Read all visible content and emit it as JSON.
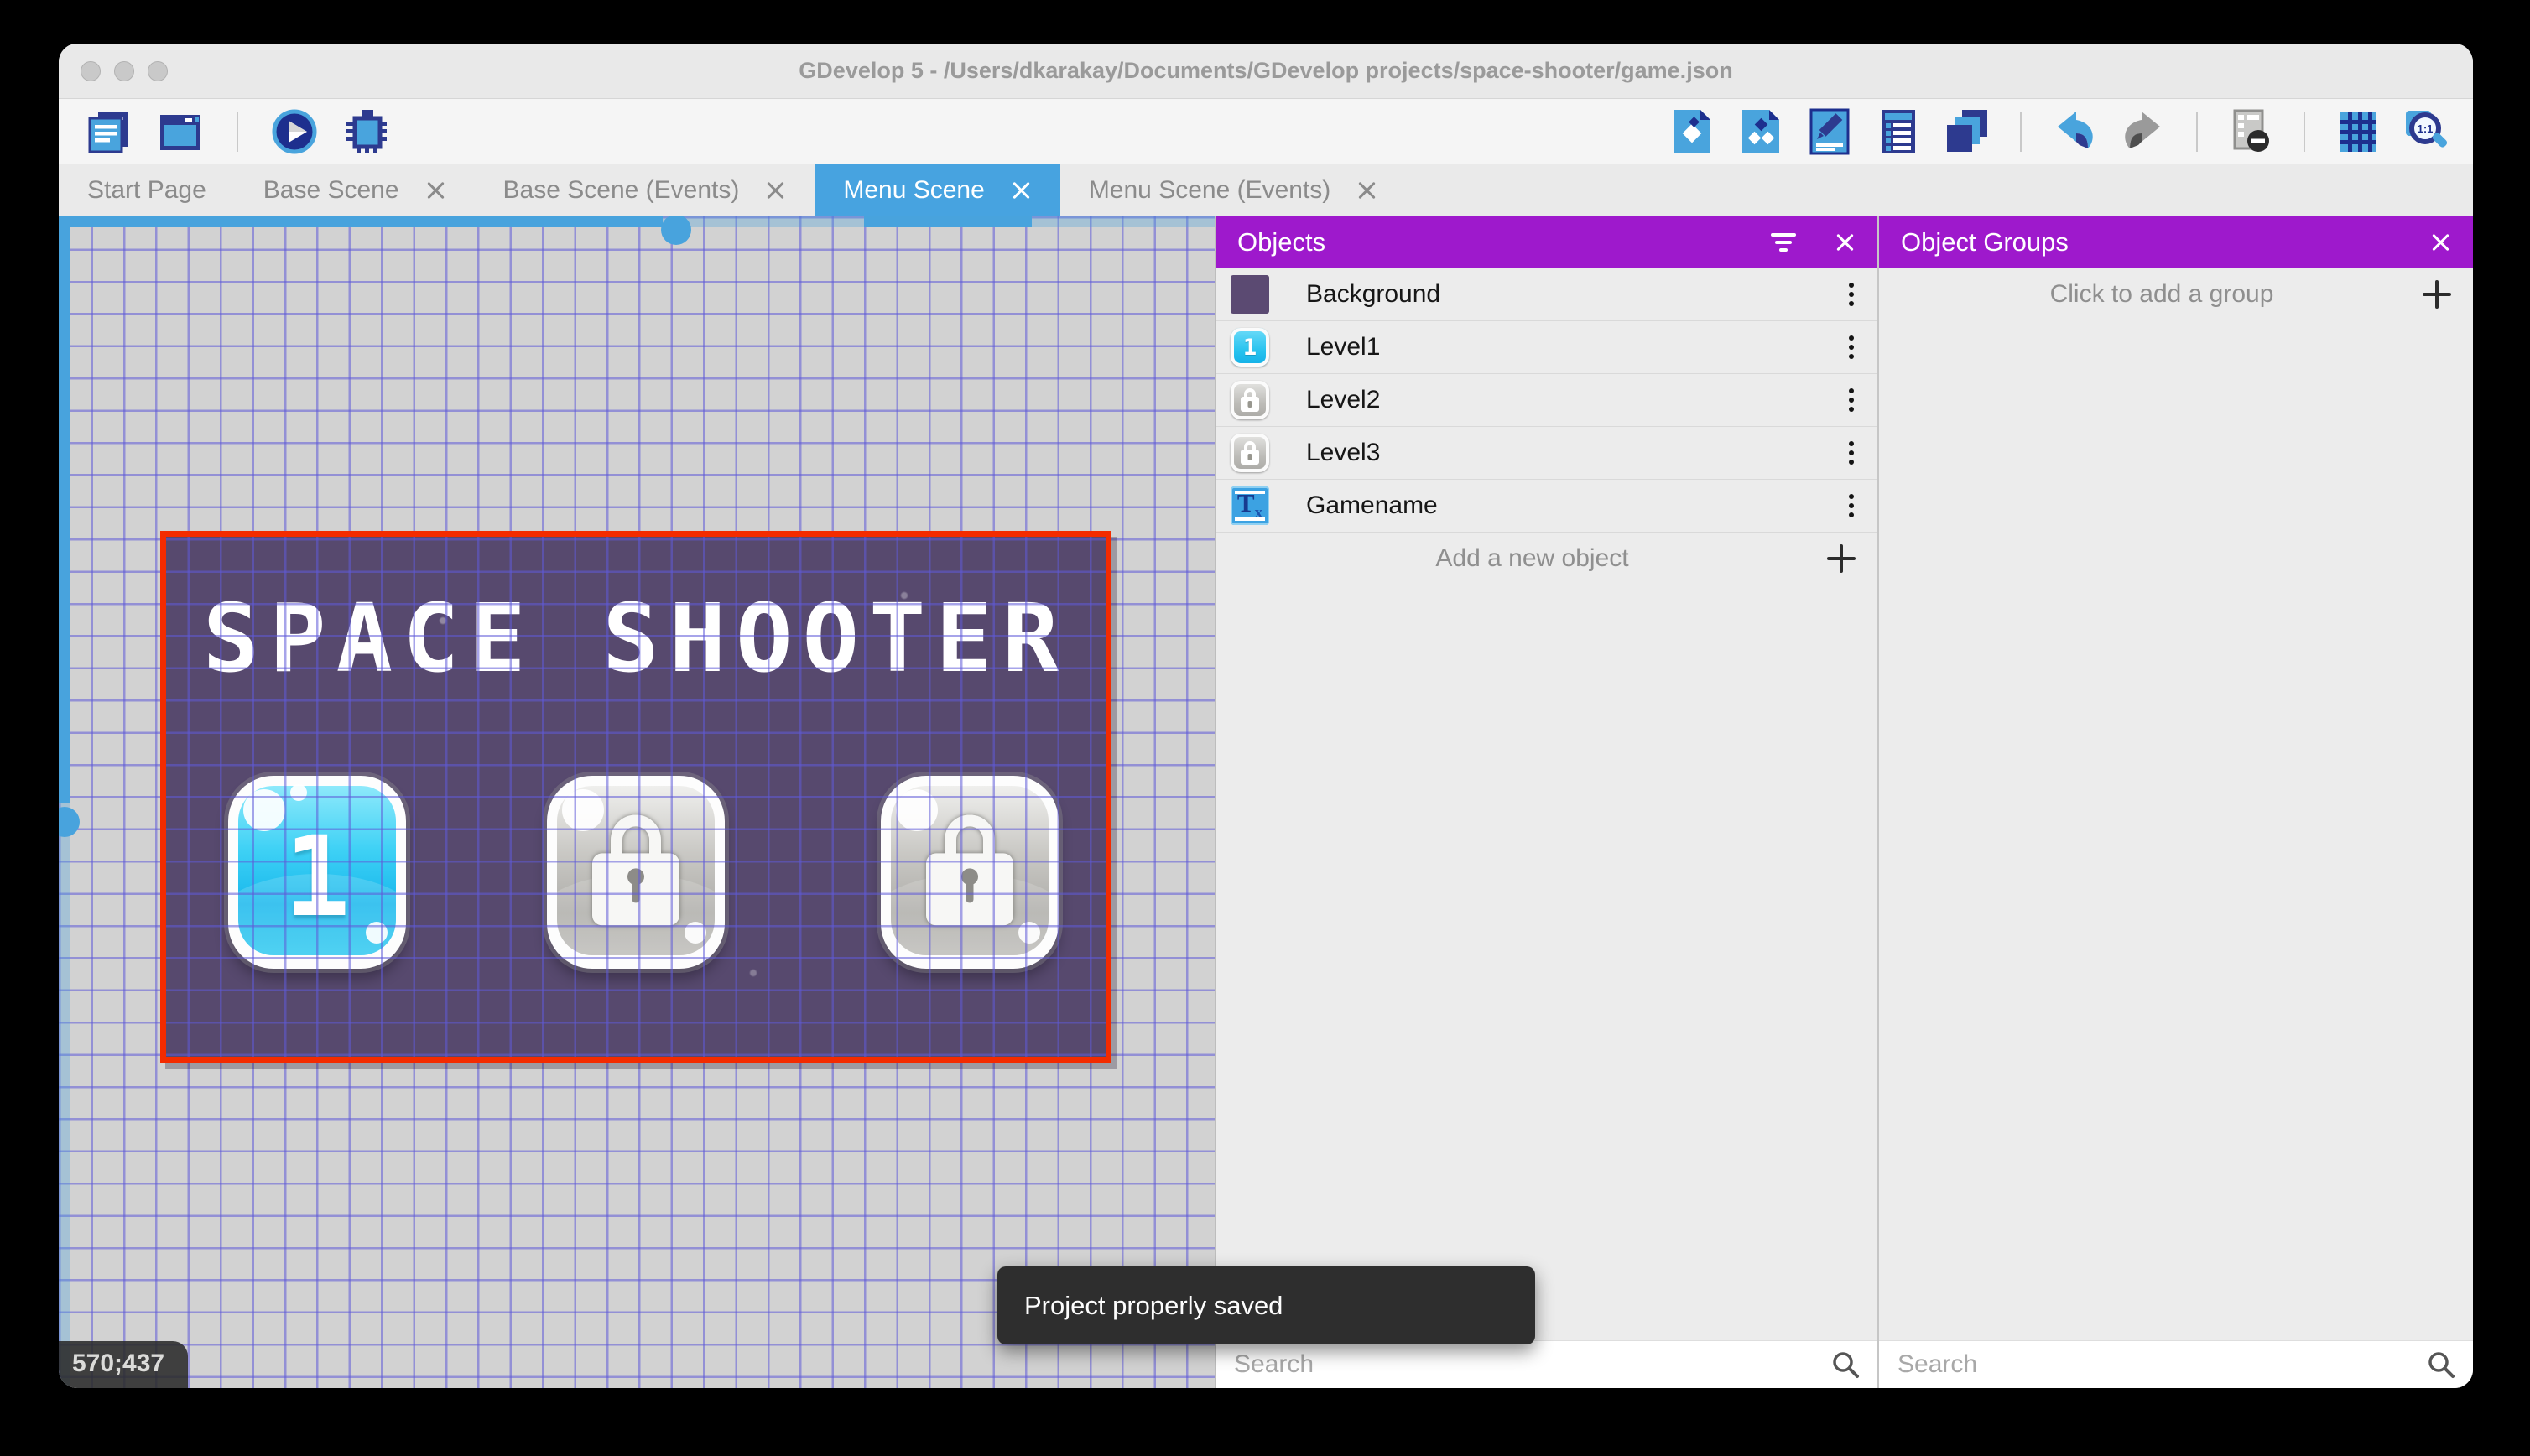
{
  "window": {
    "title": "GDevelop 5 - /Users/dkarakay/Documents/GDevelop projects/space-shooter/game.json"
  },
  "toolbar": {
    "left_icons": [
      "project-manager",
      "preview-window",
      "play-preview",
      "debug"
    ],
    "right_icons": [
      "objects-editor",
      "object-groups-editor",
      "properties",
      "instances-list",
      "layers",
      "undo",
      "redo",
      "window-mask",
      "grid",
      "zoom-1-1"
    ],
    "zoom_icon_label": "1:1"
  },
  "tabs": [
    {
      "label": "Start Page",
      "active": false,
      "closable": false
    },
    {
      "label": "Base Scene",
      "active": false,
      "closable": true
    },
    {
      "label": "Base Scene (Events)",
      "active": false,
      "closable": true
    },
    {
      "label": "Menu Scene",
      "active": true,
      "closable": true
    },
    {
      "label": "Menu Scene (Events)",
      "active": false,
      "closable": true
    }
  ],
  "canvas": {
    "coordinates": "570;437",
    "scene": {
      "title": "SPACE SHOOTER",
      "buttons": [
        {
          "label": "1",
          "state": "unlocked"
        },
        {
          "label": "",
          "state": "locked"
        },
        {
          "label": "",
          "state": "locked"
        }
      ]
    }
  },
  "objects_panel": {
    "title": "Objects",
    "items": [
      {
        "label": "Background",
        "icon": "background-swatch",
        "glyph": ""
      },
      {
        "label": "Level1",
        "icon": "level-button-unlocked",
        "glyph": "1"
      },
      {
        "label": "Level2",
        "icon": "level-button-locked",
        "glyph": ""
      },
      {
        "label": "Level3",
        "icon": "level-button-locked",
        "glyph": ""
      },
      {
        "label": "Gamename",
        "icon": "text-object",
        "glyph": "T"
      }
    ],
    "add_label": "Add a new object",
    "search_placeholder": "Search"
  },
  "object_groups_panel": {
    "title": "Object Groups",
    "empty_label": "Click to add a group",
    "search_placeholder": "Search"
  },
  "toast": {
    "message": "Project properly saved"
  },
  "colors": {
    "accent_blue": "#47a3e0",
    "panel_purple": "#9e19cc",
    "scene_background": "#57496e",
    "grid_line": "#6e66d0",
    "scene_border": "#f32b00",
    "toolbar_icon_blue": "#49a4dd",
    "toolbar_icon_navy": "#2d3a8f"
  }
}
